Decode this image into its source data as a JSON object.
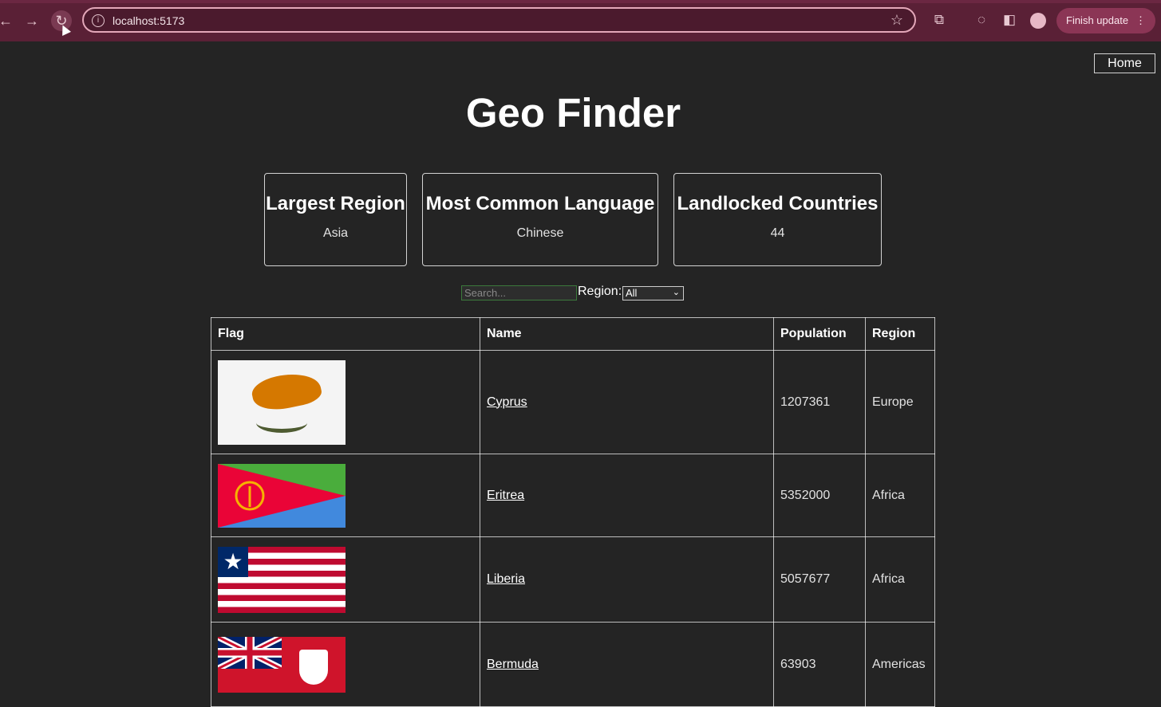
{
  "browser": {
    "url": "localhost:5173",
    "finish_update_label": "Finish update",
    "icons": [
      "back-arrow-icon",
      "forward-arrow-icon",
      "reload-icon",
      "site-info-icon",
      "bookmark-star-icon",
      "extensions-icon",
      "performance-icon",
      "side-panel-icon",
      "profile-avatar-icon",
      "more-menu-icon"
    ]
  },
  "nav": {
    "home_label": "Home"
  },
  "page": {
    "title": "Geo Finder"
  },
  "stats": [
    {
      "title": "Largest Region",
      "value": "Asia"
    },
    {
      "title": "Most Common Language",
      "value": "Chinese"
    },
    {
      "title": "Landlocked Countries",
      "value": "44"
    }
  ],
  "filters": {
    "search_placeholder": "Search...",
    "region_label": "Region:",
    "region_selected": "All"
  },
  "table": {
    "headers": [
      "Flag",
      "Name",
      "Population",
      "Region"
    ],
    "rows": [
      {
        "name": "Cyprus",
        "population": "1207361",
        "region": "Europe"
      },
      {
        "name": "Eritrea",
        "population": "5352000",
        "region": "Africa"
      },
      {
        "name": "Liberia",
        "population": "5057677",
        "region": "Africa"
      },
      {
        "name": "Bermuda",
        "population": "63903",
        "region": "Americas"
      }
    ]
  },
  "colors": {
    "page_bg": "#242424",
    "browser_frame": "#5a2036",
    "accent_button": "#8b3555"
  }
}
